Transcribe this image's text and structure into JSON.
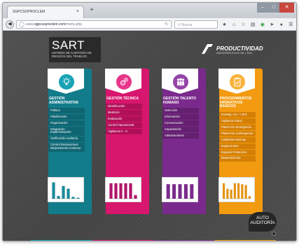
{
  "browser": {
    "tab_title": "SGPCSOPROCLEM",
    "tab_close": "×",
    "new_tab": "+",
    "url_prefix": "www.",
    "url_domain": "sgpcsoproclem.com",
    "url_path": "/menu.php",
    "search_placeholder": "Buscar",
    "win_min": "–",
    "win_max": "□",
    "win_close": "✕"
  },
  "header": {
    "title": "SART",
    "subtitle": "SISTEMA DE AUDITORÍA DE RIESGOS DEL TRABAJO",
    "logo_name": "PRODUCTIVIDAD",
    "logo_tagline": "ASESORES PLUS CÍA. LTDA."
  },
  "columns": [
    {
      "key": "teal",
      "heading": "GESTIÓN ADMINISTRATIVA",
      "icon": "lightbulb-icon",
      "color": "#137c8a",
      "items": [
        "Política",
        "Planificación",
        "Organización",
        "Integración Implementación",
        "Verificación Auditoría",
        "Control Desviaciones Mejoramiento Continuo"
      ]
    },
    {
      "key": "pink",
      "heading": "GESTIÓN TÉCNICA",
      "icon": "gears-icon",
      "color": "#d7166d",
      "items": [
        "Identificación",
        "Medición",
        "Evaluación",
        "Control Operacional",
        "Vigilancia A - S"
      ]
    },
    {
      "key": "purple",
      "heading": "GESTIÓN TALENTO HUMANO",
      "icon": "people-icon",
      "color": "#7a2a8c",
      "items": [
        "Selección",
        "Información",
        "Comunicación",
        "Capacitación",
        "Adiestramiento"
      ]
    },
    {
      "key": "orange",
      "heading": "PROCEDIMIENTOS OPERATIVOS BÁSICOS",
      "icon": "clipboard-icon",
      "color": "#f29a10",
      "items": [
        "Investig. Acc. Y Enf.",
        "Vigilancia Salud",
        "Planes De Emergencia",
        "Planes De Contingencia",
        "Auditorías Internas",
        "Inspecciones",
        "Equipos Protección",
        "Mantenimiento"
      ]
    }
  ],
  "charts": [
    {
      "color": "#1a8a9a",
      "values": [
        0.9,
        0.15,
        0.7,
        0.55,
        0.1,
        0.05
      ]
    },
    {
      "color": "#b0156a",
      "values": [
        0.85,
        0.85,
        0.85,
        0.85,
        0.85,
        0.2
      ]
    },
    {
      "color": "#7a2a8c",
      "values": [
        0.8,
        0.8,
        0.8,
        0.8,
        0.8
      ]
    },
    {
      "color": "#e5920d",
      "values": [
        0.85,
        0.55,
        0.5,
        0.85,
        0.85,
        0.8,
        0.75,
        0.15
      ]
    }
  ],
  "auto_auditoria": {
    "label_line1": "AUTO",
    "label_line2": "AUDITORÍA"
  },
  "bottom_line_colors": [
    "#19a3b5",
    "#d7166d",
    "#7a2a8c",
    "#f29a10"
  ]
}
